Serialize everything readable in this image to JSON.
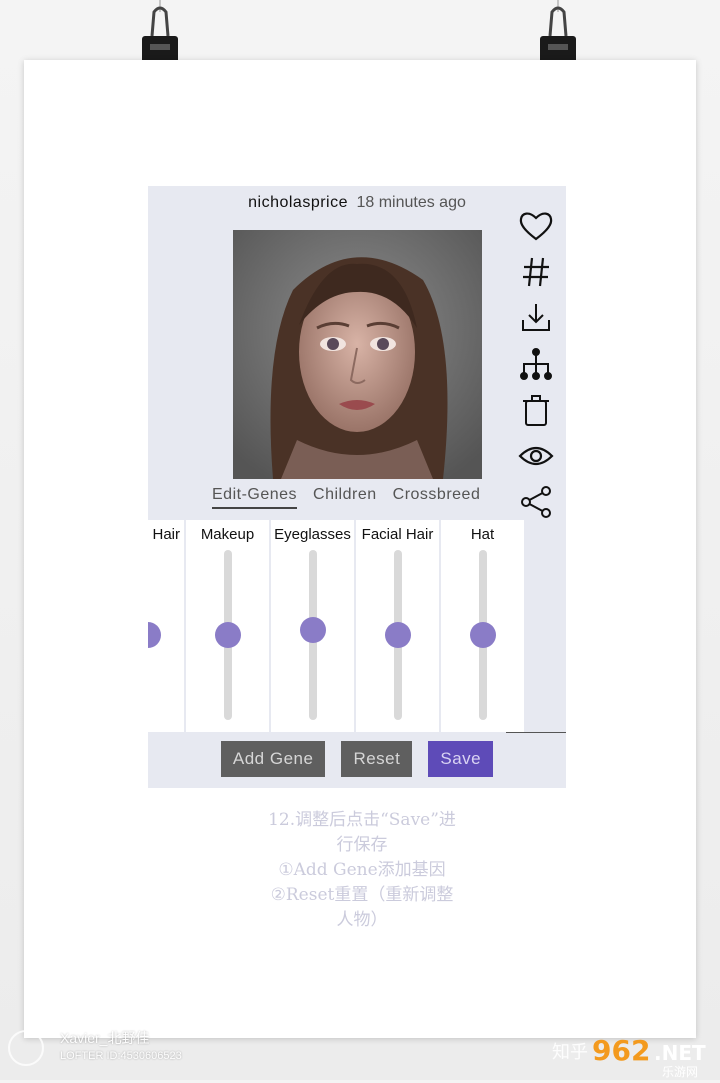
{
  "post": {
    "username": "nicholasprice",
    "time": "18 minutes ago"
  },
  "side_actions": [
    {
      "icon": "heart-icon"
    },
    {
      "icon": "hashtag-icon"
    },
    {
      "icon": "download-icon"
    },
    {
      "icon": "family-tree-icon"
    },
    {
      "icon": "trash-icon"
    },
    {
      "icon": "eye-icon"
    },
    {
      "icon": "share-icon"
    }
  ],
  "tabs": [
    {
      "label": "Edit-Genes",
      "active": true
    },
    {
      "label": "Children",
      "active": false
    },
    {
      "label": "Crossbreed",
      "active": false
    }
  ],
  "genes": [
    {
      "label": "Hair",
      "value": 0.5
    },
    {
      "label": "Makeup",
      "value": 0.5
    },
    {
      "label": "Eyeglasses",
      "value": 0.53
    },
    {
      "label": "Facial Hair",
      "value": 0.5
    },
    {
      "label": "Hat",
      "value": 0.5
    }
  ],
  "buttons": {
    "add_gene": "Add Gene",
    "reset": "Reset",
    "save": "Save"
  },
  "caption": {
    "line1": "12.调整后点击“Save”进",
    "line2": "行保存",
    "line3": "①Add Gene添加基因",
    "line4": "②Reset重置（重新调整",
    "line5": "人物）"
  },
  "watermarks": {
    "left_name": "Xavier_北野佳",
    "left_id": "LOFTER ID:4530606523",
    "right": "知乎 962.NET 乐游网"
  },
  "colors": {
    "accent": "#8a7cc7",
    "save_button": "#5e4bb8",
    "panel_bg": "#e7e9f1"
  }
}
